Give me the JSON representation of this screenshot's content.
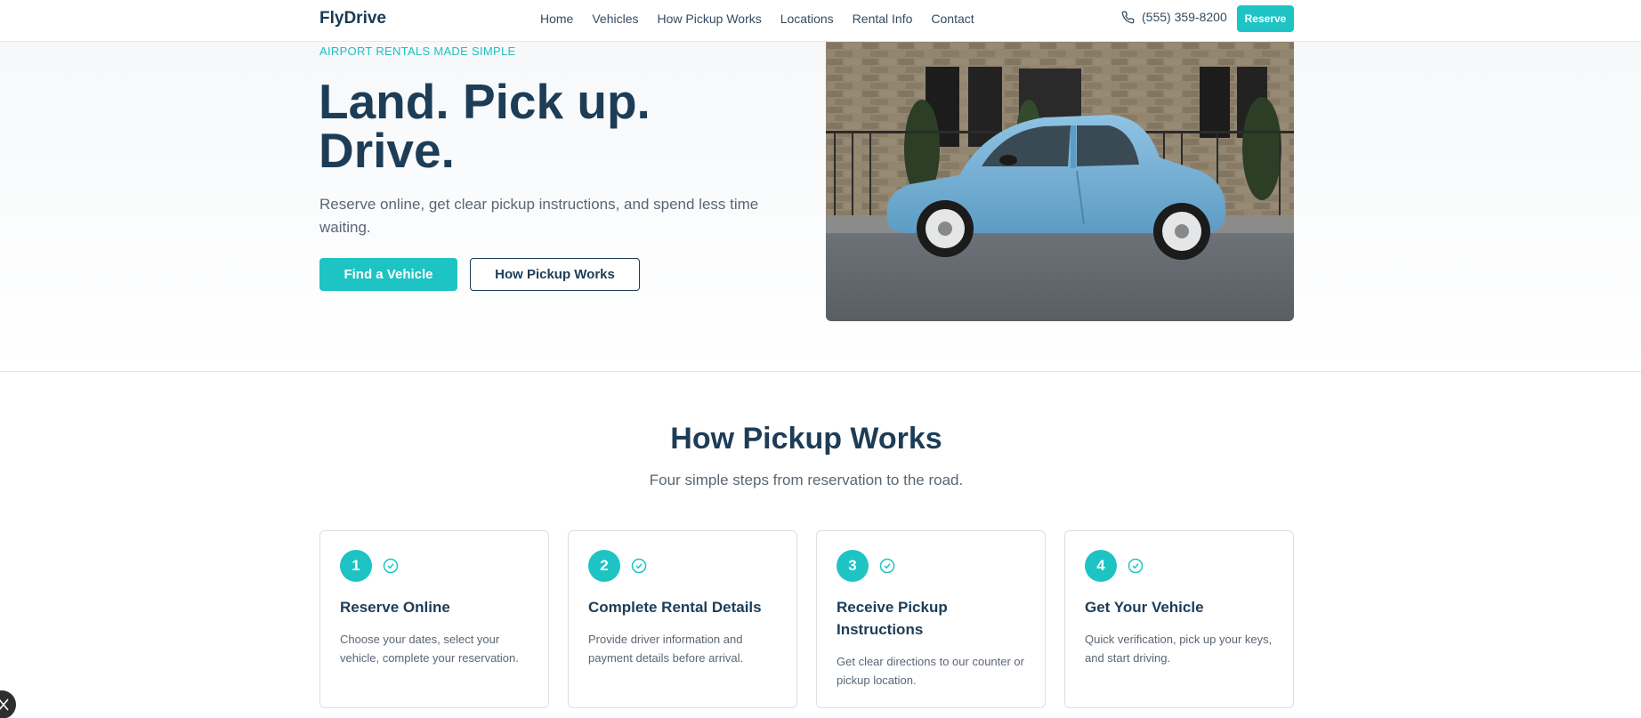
{
  "header": {
    "brand": "FlyDrive",
    "nav": [
      "Home",
      "Vehicles",
      "How Pickup Works",
      "Locations",
      "Rental Info",
      "Contact"
    ],
    "phone": "(555) 359-8200",
    "reserve_label": "Reserve"
  },
  "hero": {
    "eyebrow": "AIRPORT RENTALS MADE SIMPLE",
    "headline": "Land. Pick up. Drive.",
    "subtitle": "Reserve online, get clear pickup instructions, and spend less time waiting.",
    "primary_cta": "Find a Vehicle",
    "secondary_cta": "How Pickup Works",
    "image": "light-blue-compact-car"
  },
  "steps_section": {
    "title": "How Pickup Works",
    "subtitle": "Four simple steps from reservation to the road.",
    "steps": [
      {
        "number": "1",
        "title": "Reserve Online",
        "description": "Choose your dates, select your vehicle, complete your reservation."
      },
      {
        "number": "2",
        "title": "Complete Rental Details",
        "description": "Provide driver information and payment details before arrival."
      },
      {
        "number": "3",
        "title": "Receive Pickup Instructions",
        "description": "Get clear directions to our counter or pickup location."
      },
      {
        "number": "4",
        "title": "Get Your Vehicle",
        "description": "Quick verification, pick up your keys, and start driving."
      }
    ]
  },
  "colors": {
    "accent": "#1ec4c4",
    "heading": "#1d3d57",
    "body_text": "#5a6675"
  },
  "icons": [
    "phone-icon",
    "check-circle-icon"
  ]
}
